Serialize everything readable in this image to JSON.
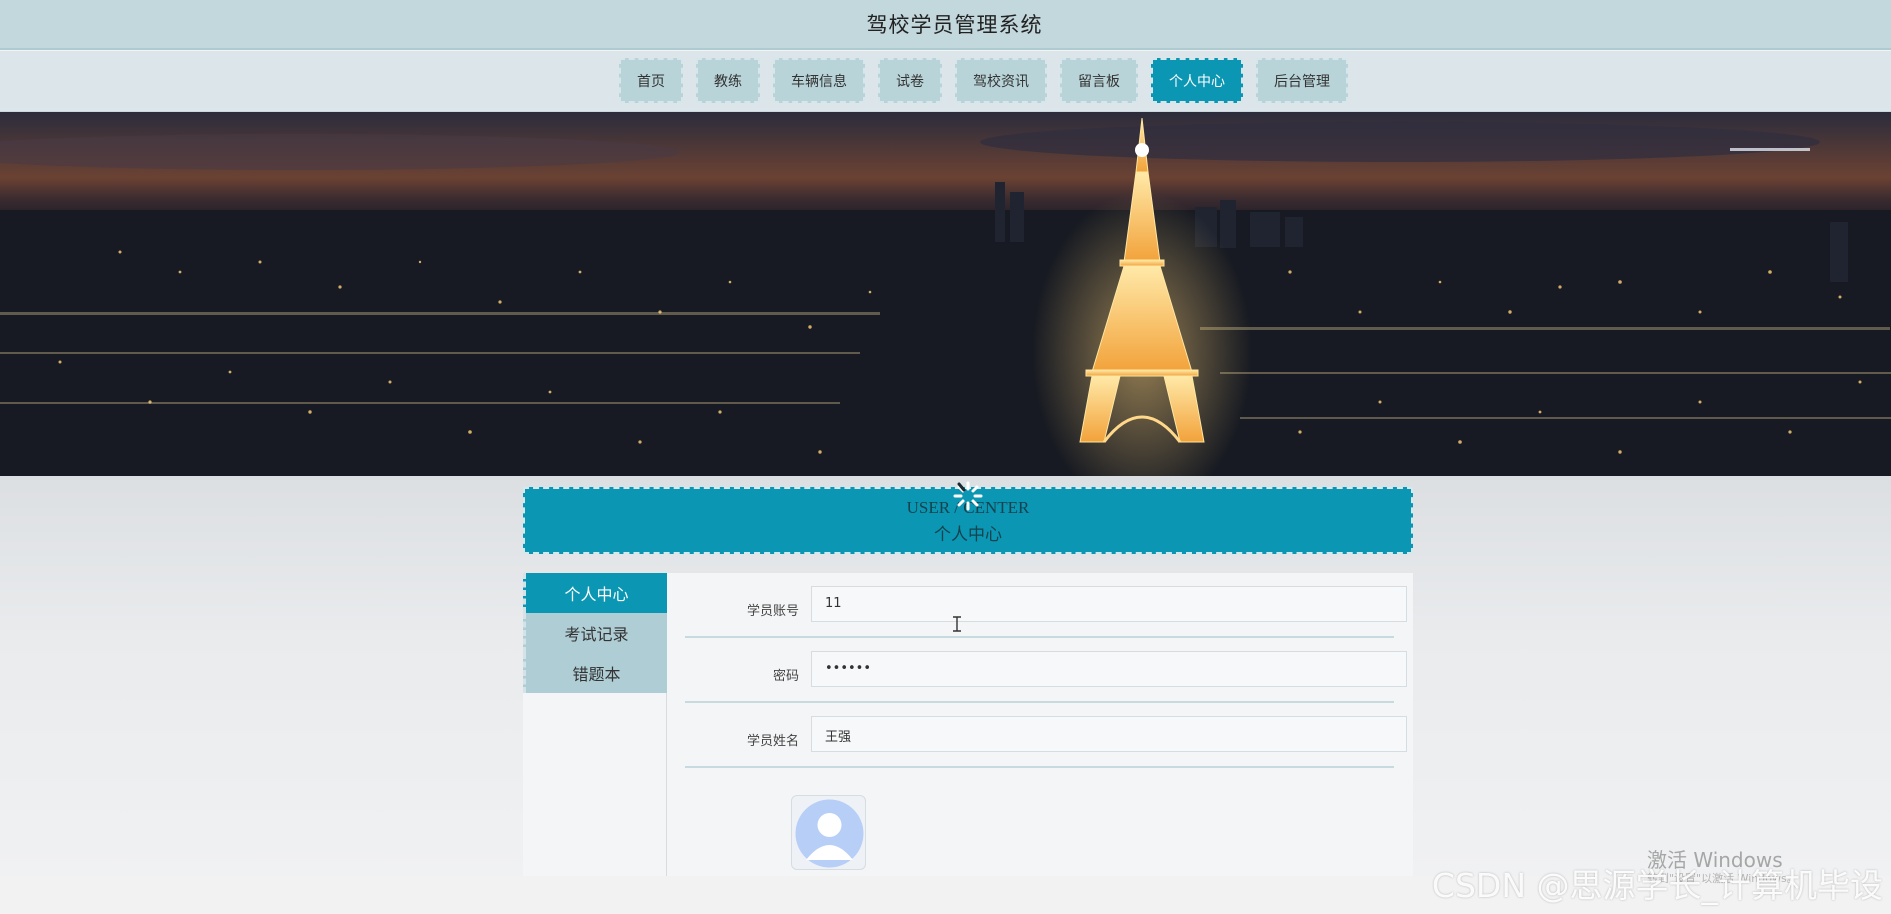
{
  "header": {
    "title": "驾校学员管理系统"
  },
  "nav": {
    "items": [
      {
        "label": "首页"
      },
      {
        "label": "教练"
      },
      {
        "label": "车辆信息"
      },
      {
        "label": "试卷"
      },
      {
        "label": "驾校资讯"
      },
      {
        "label": "留言板"
      },
      {
        "label": "个人中心",
        "active": true
      },
      {
        "label": "后台管理"
      }
    ]
  },
  "center_header": {
    "en": "USER / CENTER",
    "cn": "个人中心"
  },
  "sidebar": {
    "items": [
      {
        "label": "个人中心",
        "active": true
      },
      {
        "label": "考试记录"
      },
      {
        "label": "错题本"
      }
    ]
  },
  "form": {
    "account": {
      "label": "学员账号",
      "value": "11"
    },
    "password": {
      "label": "密码",
      "value": "••••••"
    },
    "name": {
      "label": "学员姓名",
      "value": "王强"
    }
  },
  "icons": {
    "spinner": "loading-spinner-icon",
    "avatar": "user-avatar-icon",
    "cursor": "text-cursor-icon"
  },
  "colors": {
    "accent": "#0b97b3",
    "nav_bg": "#b8d4d9",
    "title_bg": "#c2d8dd"
  },
  "watermarks": {
    "windows": "激活 Windows",
    "windows_sub": "转到\"设置\"以激活 Windows。",
    "csdn": "CSDN @思源学长_计算机毕设"
  }
}
